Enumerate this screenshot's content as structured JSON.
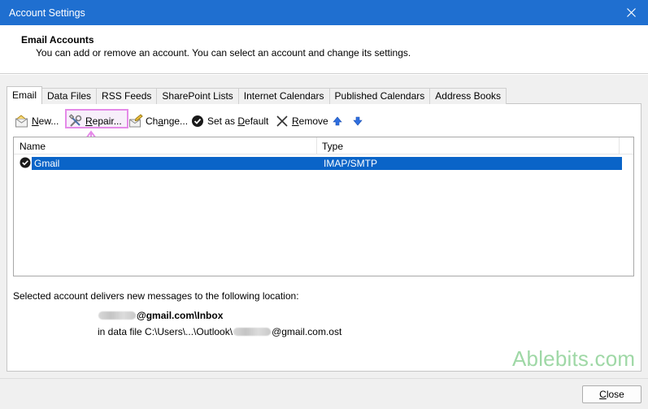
{
  "window": {
    "title": "Account Settings"
  },
  "header": {
    "title": "Email Accounts",
    "subtitle": "You can add or remove an account. You can select an account and change its settings."
  },
  "tabs": [
    {
      "label": "Email",
      "active": true
    },
    {
      "label": "Data Files",
      "active": false
    },
    {
      "label": "RSS Feeds",
      "active": false
    },
    {
      "label": "SharePoint Lists",
      "active": false
    },
    {
      "label": "Internet Calendars",
      "active": false
    },
    {
      "label": "Published Calendars",
      "active": false
    },
    {
      "label": "Address Books",
      "active": false
    }
  ],
  "toolbar": {
    "new_pre": "",
    "new_u": "N",
    "new_post": "ew...",
    "repair_pre": "",
    "repair_u": "R",
    "repair_post": "epair...",
    "change_pre": "Ch",
    "change_u": "a",
    "change_post": "nge...",
    "default_pre": "Set as ",
    "default_u": "D",
    "default_post": "efault",
    "remove_pre": "",
    "remove_u": "R",
    "remove_post": "emove"
  },
  "accounts_table": {
    "columns": [
      "Name",
      "Type"
    ],
    "rows": [
      {
        "name": "Gmail",
        "type": "IMAP/SMTP",
        "selected": true,
        "is_default": true
      }
    ]
  },
  "delivery": {
    "label": "Selected account delivers new messages to the following location:",
    "inbox_suffix": "@gmail.com\\Inbox",
    "datafile_prefix": "in data file C:\\Users\\...\\Outlook\\",
    "datafile_suffix": "@gmail.com.ost"
  },
  "watermark": {
    "text": "Ablebits",
    "suffix": ".com"
  },
  "footer": {
    "close_pre": "",
    "close_u": "C",
    "close_post": "lose"
  },
  "colors": {
    "titlebar": "#1f6fd0",
    "selection": "#0a64c8",
    "highlight": "#e58ae8",
    "arrow_blue": "#1e64dc"
  }
}
